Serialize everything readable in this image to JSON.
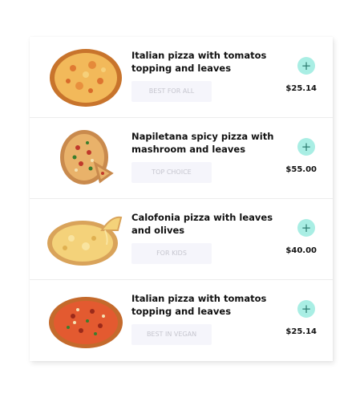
{
  "menu": {
    "items": [
      {
        "title": "Italian pizza with tomatos topping and leaves",
        "tag": "BEST FOR ALL",
        "price": "$25.14",
        "add_icon": "plus-icon"
      },
      {
        "title": "Napiletana spicy pizza with mashroom and leaves",
        "tag": "TOP CHOICE",
        "price": "$55.00",
        "add_icon": "plus-icon"
      },
      {
        "title": "Calofonia pizza with leaves and olives",
        "tag": "FOR KIDS",
        "price": "$40.00",
        "add_icon": "plus-icon"
      },
      {
        "title": "Italian pizza with tomatos topping and leaves",
        "tag": "BEST IN VEGAN",
        "price": "$25.14",
        "add_icon": "plus-icon"
      }
    ]
  },
  "colors": {
    "accent": "#a9eee4",
    "tag_bg": "#f5f5fb",
    "tag_text": "#c6c6cf"
  }
}
